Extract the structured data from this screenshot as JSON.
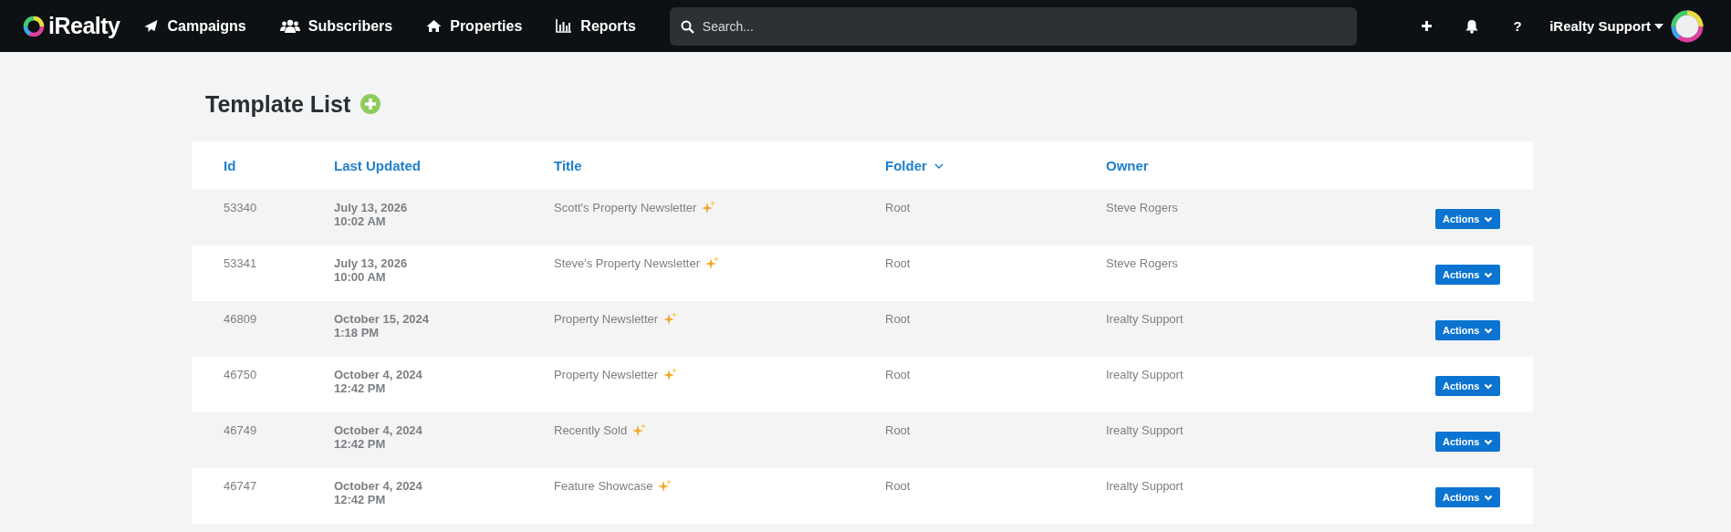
{
  "nav": {
    "brand": "iRealty",
    "items": [
      {
        "label": "Campaigns"
      },
      {
        "label": "Subscribers"
      },
      {
        "label": "Properties"
      },
      {
        "label": "Reports"
      }
    ],
    "search": {
      "placeholder": "Search..."
    },
    "help": "?",
    "user": "iRealty Support"
  },
  "page": {
    "title": "Template List"
  },
  "table": {
    "columns": [
      {
        "label": "Id",
        "sorted": false
      },
      {
        "label": "Last Updated",
        "sorted": false
      },
      {
        "label": "Title",
        "sorted": false
      },
      {
        "label": "Folder",
        "sorted": true
      },
      {
        "label": "Owner",
        "sorted": false
      }
    ],
    "rows": [
      {
        "id": "53340",
        "date": "July 13, 2026",
        "time": "10:02 AM",
        "title": "Scott's Property Newsletter",
        "folder": "Root",
        "owner": "Steve Rogers",
        "action": "Actions"
      },
      {
        "id": "53341",
        "date": "July 13, 2026",
        "time": "10:00 AM",
        "title": "Steve's Property Newsletter",
        "folder": "Root",
        "owner": "Steve Rogers",
        "action": "Actions"
      },
      {
        "id": "46809",
        "date": "October 15, 2024",
        "time": "1:18 PM",
        "title": "Property Newsletter",
        "folder": "Root",
        "owner": "Irealty Support",
        "action": "Actions"
      },
      {
        "id": "46750",
        "date": "October 4, 2024",
        "time": "12:42 PM",
        "title": "Property Newsletter",
        "folder": "Root",
        "owner": "Irealty Support",
        "action": "Actions"
      },
      {
        "id": "46749",
        "date": "October 4, 2024",
        "time": "12:42 PM",
        "title": "Recently Sold",
        "folder": "Root",
        "owner": "Irealty Support",
        "action": "Actions"
      },
      {
        "id": "46747",
        "date": "October 4, 2024",
        "time": "12:42 PM",
        "title": "Feature Showcase",
        "folder": "Root",
        "owner": "Irealty Support",
        "action": "Actions"
      }
    ]
  }
}
